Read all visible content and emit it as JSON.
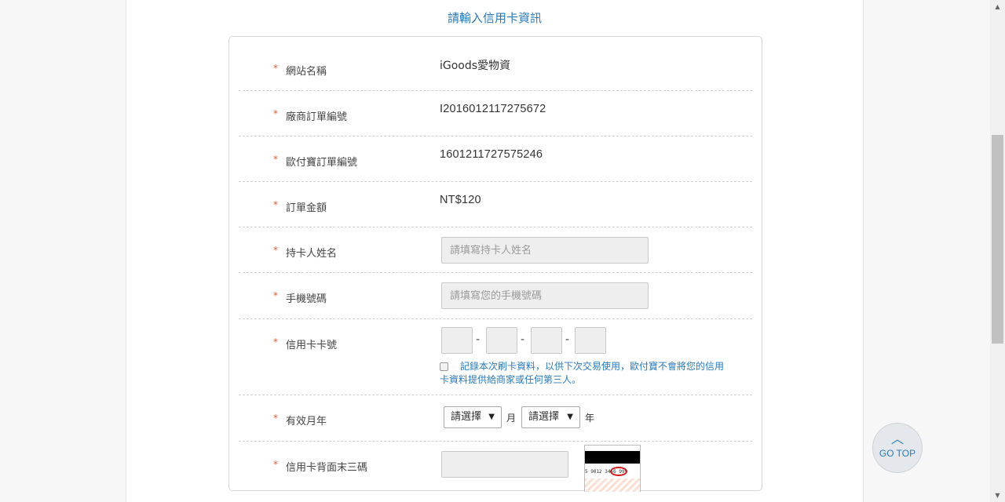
{
  "form": {
    "title": "請輸入信用卡資訊",
    "required_mark": "*"
  },
  "rows": {
    "site_name": {
      "label": "網站名稱",
      "value": "iGoods愛物資"
    },
    "merchant_order": {
      "label": "廠商訂單編號",
      "value": "I2016012117275672"
    },
    "payment_order": {
      "label": "歐付寶訂單編號",
      "value": "1601211727575246"
    },
    "amount": {
      "label": "訂單金額",
      "value": "NT$120"
    },
    "cardholder": {
      "label": "持卡人姓名",
      "placeholder": "請填寫持卡人姓名"
    },
    "mobile": {
      "label": "手機號碼",
      "placeholder": "請填寫您的手機號碼"
    },
    "card_number": {
      "label": "信用卡卡號",
      "separator": "-",
      "remember_text": "記錄本次刷卡資料，以供下次交易使用，歐付寶不會將您的信用卡資料提供給商家或任何第三人。",
      "remember_checked": false
    },
    "expiry": {
      "label": "有效月年",
      "month_select": "請選擇",
      "month_unit": "月",
      "year_select": "請選擇",
      "year_unit": "年"
    },
    "cvv": {
      "label": "信用卡背面末三碼",
      "illustration_digits": "5 9012 3456 999"
    }
  },
  "gotop": {
    "label": "GO TOP"
  },
  "colors": {
    "accent": "#2a7ab8",
    "required": "#e65a2b",
    "input_bg": "#eeeeee"
  }
}
